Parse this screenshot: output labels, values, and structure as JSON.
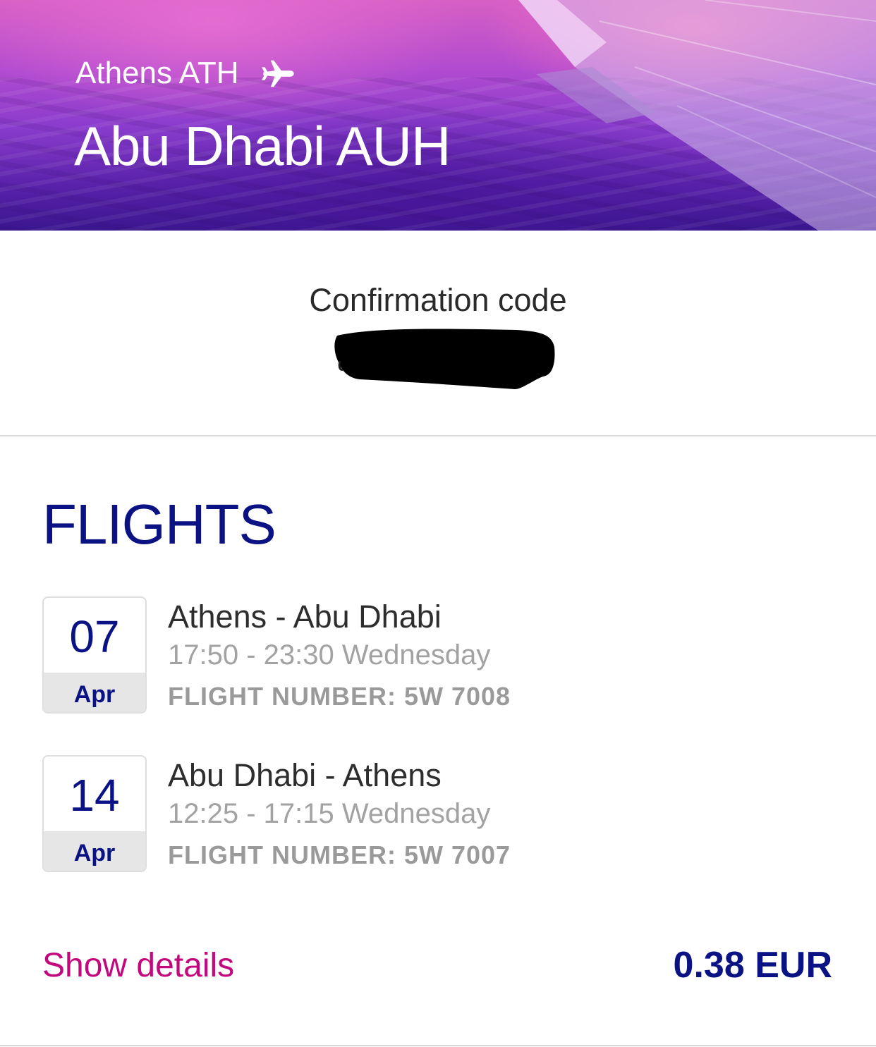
{
  "header": {
    "origin": "Athens ATH",
    "origin_icon": "airplane-icon",
    "destination": "Abu Dhabi AUH"
  },
  "booking": {
    "confirmation_label": "Confirmation code",
    "confirmation_code_redacted": true
  },
  "flights": {
    "title": "FLIGHTS",
    "items": [
      {
        "day": "07",
        "month": "Apr",
        "route": "Athens - Abu Dhabi",
        "time": "17:50 - 23:30 Wednesday",
        "flight_number": "FLIGHT NUMBER: 5W 7008"
      },
      {
        "day": "14",
        "month": "Apr",
        "route": "Abu Dhabi - Athens",
        "time": "12:25 - 17:15 Wednesday",
        "flight_number": "FLIGHT NUMBER: 5W 7007"
      }
    ]
  },
  "footer": {
    "show_details_label": "Show details",
    "price": "0.38 EUR"
  },
  "colors": {
    "brand_navy": "#0b1384",
    "brand_magenta": "#c3077d",
    "muted_text": "#a2a2a2"
  }
}
